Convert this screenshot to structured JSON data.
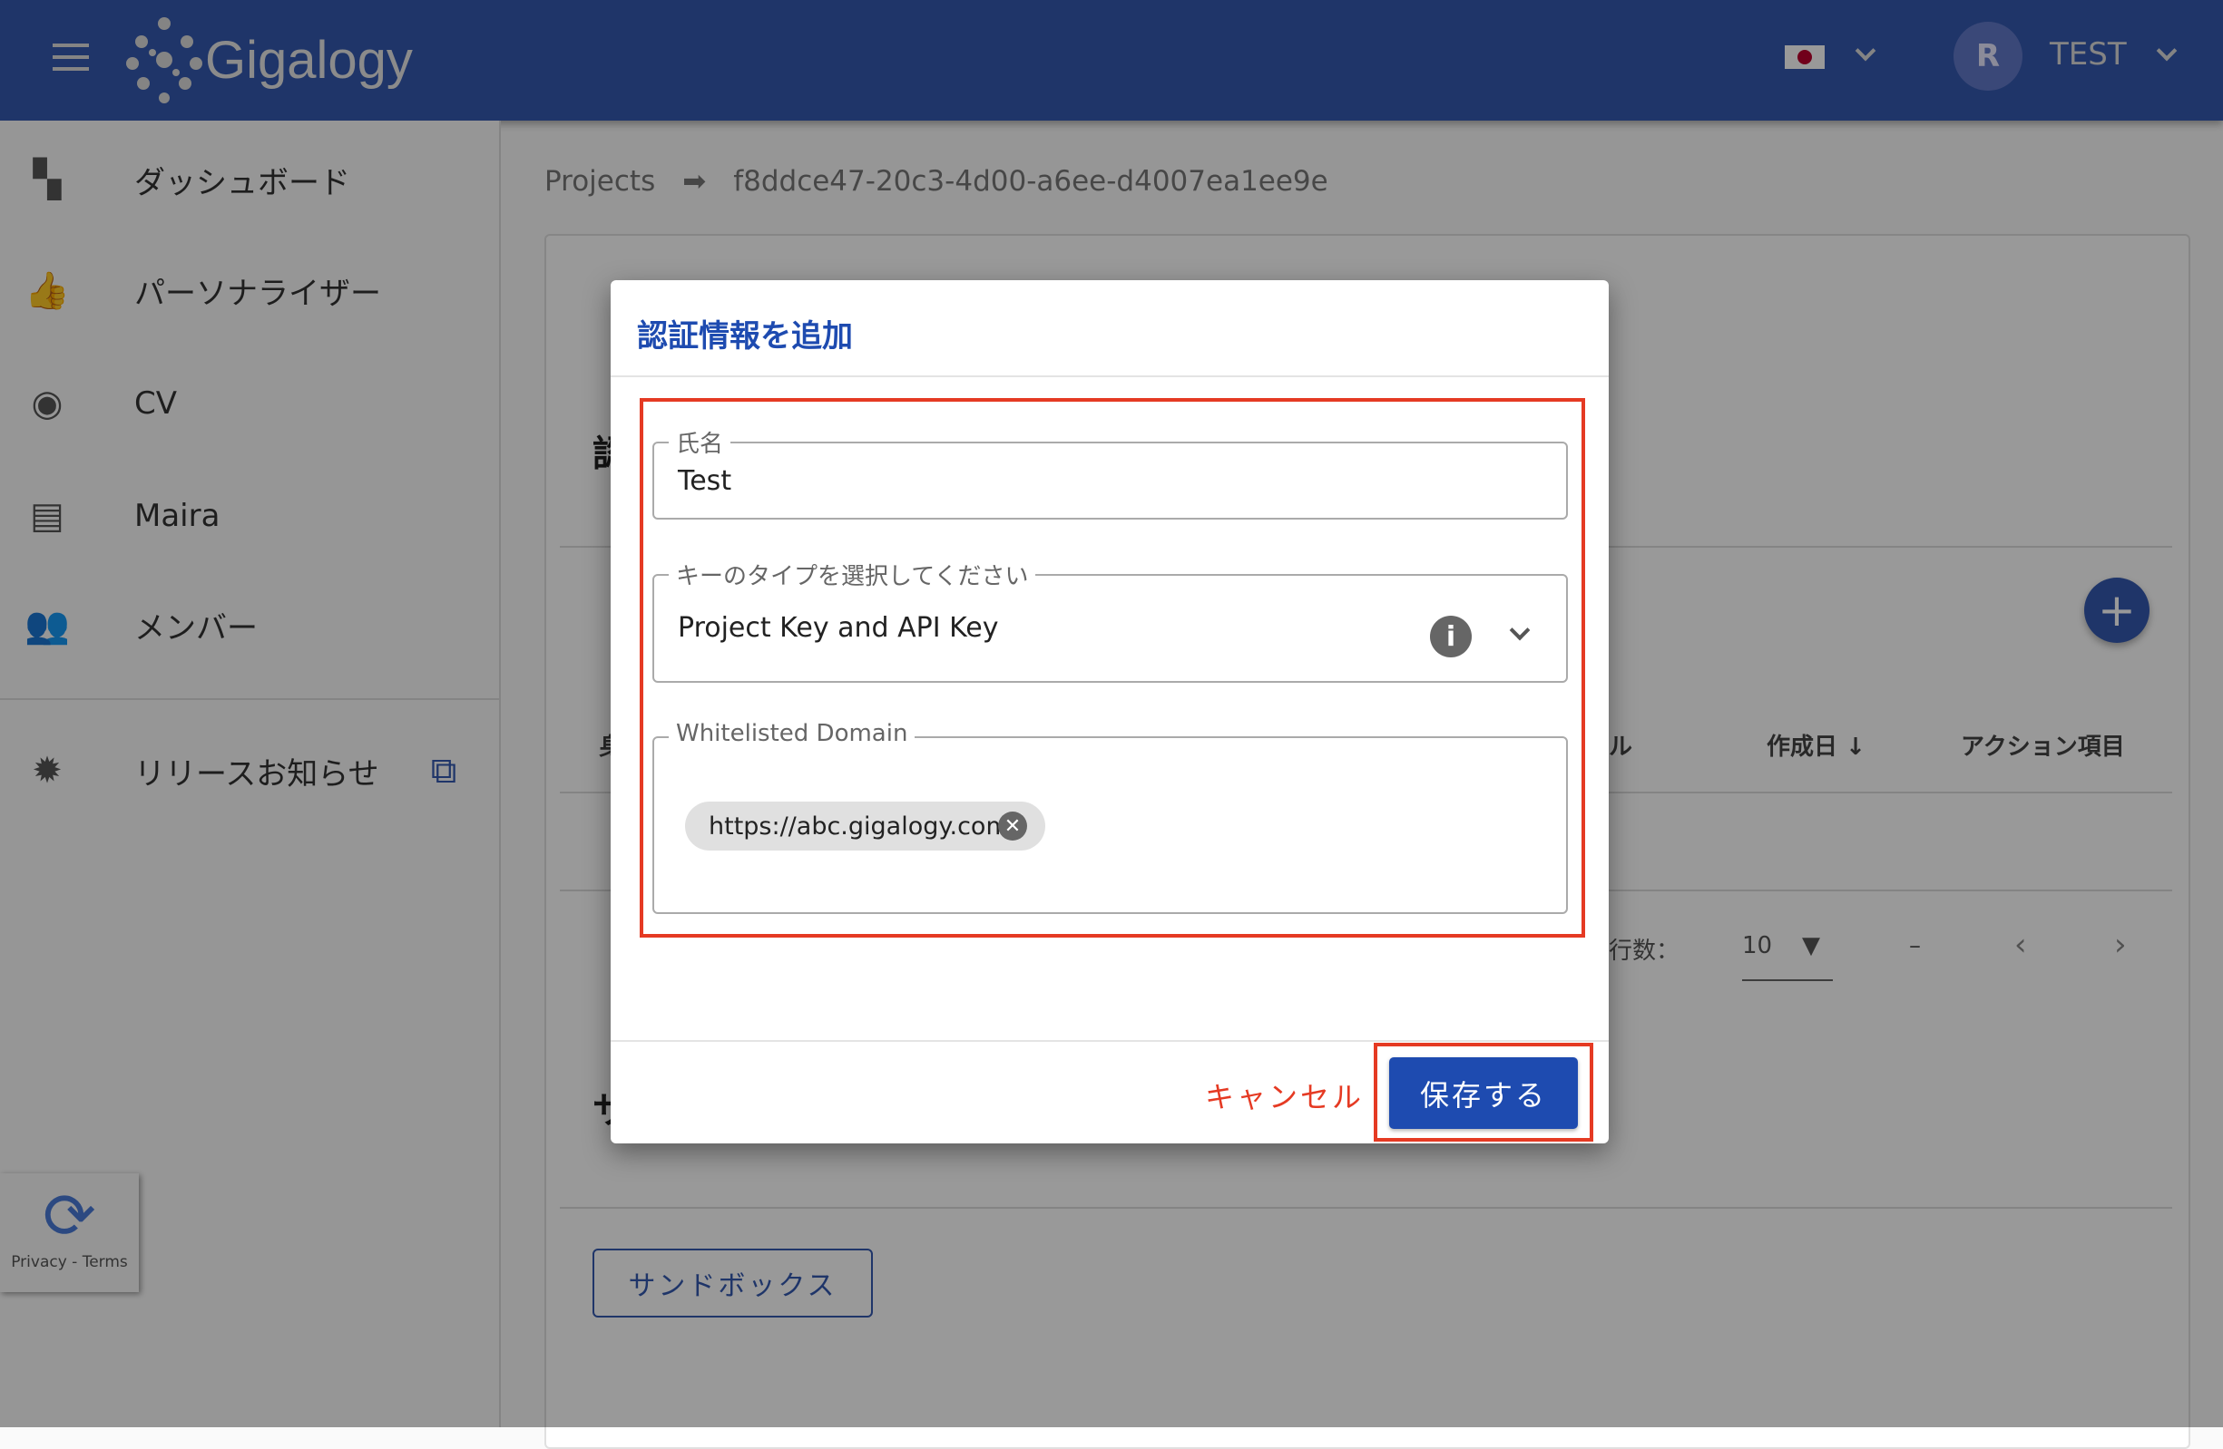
{
  "header": {
    "logo_text": "Gigalogy",
    "language_flag": "japan-flag",
    "avatar_initial": "R",
    "user_name": "TEST"
  },
  "sidebar": {
    "items": [
      {
        "label": "ダッシュボード",
        "icon": "dashboard-icon"
      },
      {
        "label": "パーソナライザー",
        "icon": "thumb-up-icon"
      },
      {
        "label": "CV",
        "icon": "eye-icon"
      },
      {
        "label": "Maira",
        "icon": "chat-icon"
      },
      {
        "label": "メンバー",
        "icon": "people-icon"
      }
    ],
    "release": {
      "label": "リリースお知らせ",
      "icon": "alert-badge-icon"
    }
  },
  "breadcrumb": {
    "root": "Projects",
    "current": "f8ddce47-20c3-4d00-a6ee-d4007ea1ee9e"
  },
  "background": {
    "table_headers": {
      "partial_left": "身",
      "partial_mid": "ル",
      "created": "作成日",
      "actions": "アクション項目"
    },
    "pagination": {
      "rows_label": "行数：",
      "rows_value": "10",
      "range": "–"
    },
    "section_partial_1": "認",
    "section_partial_2": "サ",
    "sandbox_button": "サンドボックス"
  },
  "recaptcha": {
    "links": "Privacy - Terms"
  },
  "modal": {
    "title": "認証情報を追加",
    "name_field": {
      "label": "氏名",
      "value": "Test"
    },
    "key_type_field": {
      "label": "キーのタイプを選択してください",
      "value": "Project Key and API Key"
    },
    "domain_field": {
      "label": "Whitelisted Domain",
      "chips": [
        "https://abc.gigalogy.com"
      ]
    },
    "cancel": "キャンセル",
    "save": "保存する"
  },
  "colors": {
    "brand": "#3459af",
    "title_blue": "#1e4bb0",
    "cancel_red": "#e53a23",
    "save_blue": "#1e4bb0",
    "highlight": "#e53a23"
  }
}
